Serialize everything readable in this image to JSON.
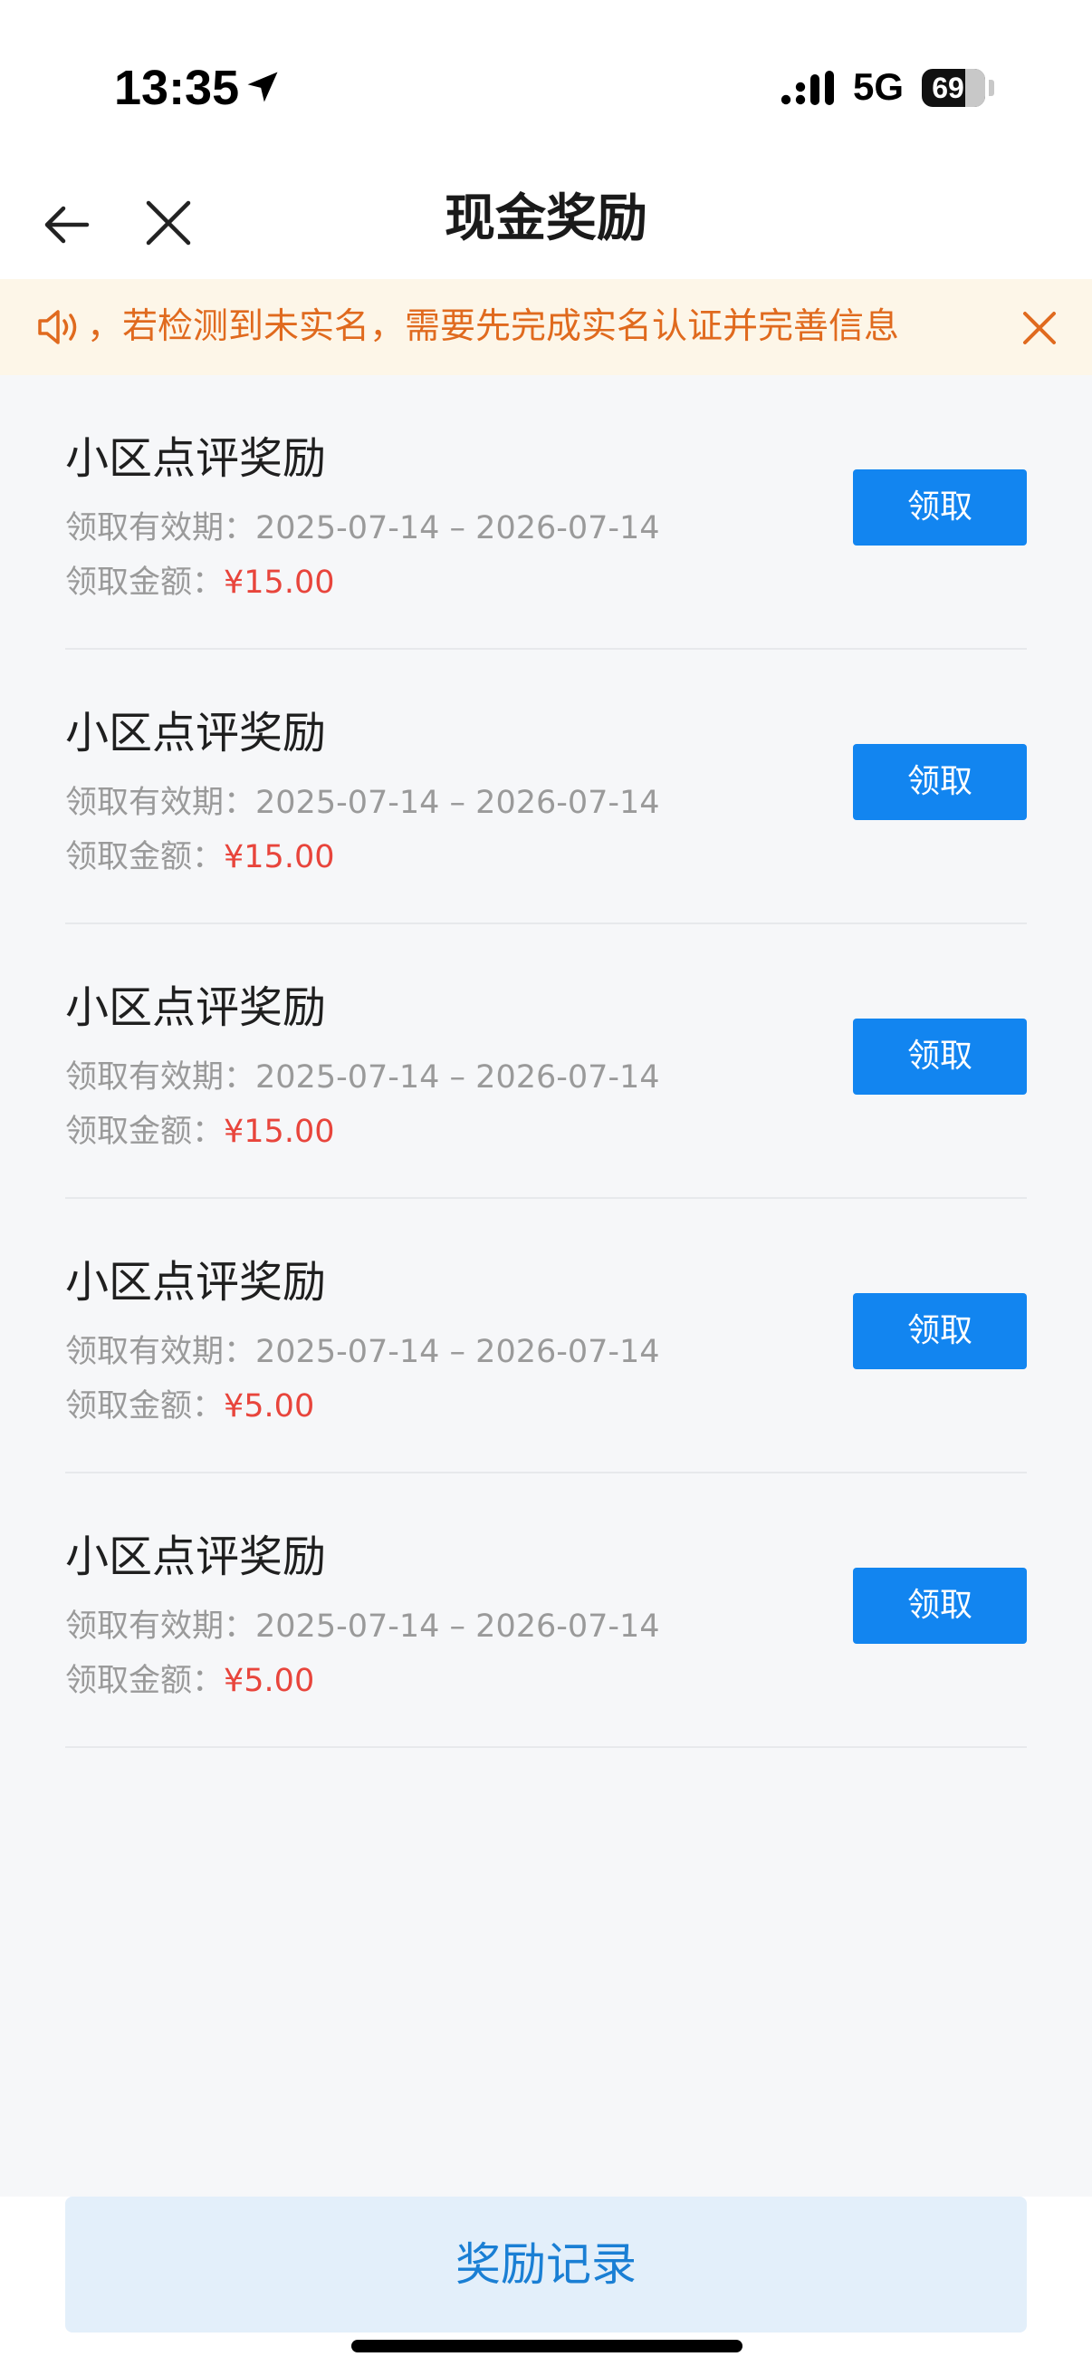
{
  "status_bar": {
    "time": "13:35",
    "network": "5G",
    "battery_level": "69",
    "battery_fraction": 0.69
  },
  "nav": {
    "title": "现金奖励",
    "back_icon": "arrow-left-icon",
    "close_icon": "close-icon"
  },
  "notice": {
    "icon": "speaker-icon",
    "text": "，若检测到未实名，需要先完成实名认证并完善信息",
    "color": "#e06a1e",
    "background": "#fdf6e8"
  },
  "rewards": [
    {
      "title": "小区点评奖励",
      "period_label": "领取有效期：",
      "period": "2025-07-14 – 2026-07-14",
      "amount_label": "领取金额：",
      "amount": "¥15.00",
      "button": "领取"
    },
    {
      "title": "小区点评奖励",
      "period_label": "领取有效期：",
      "period": "2025-07-14 – 2026-07-14",
      "amount_label": "领取金额：",
      "amount": "¥15.00",
      "button": "领取"
    },
    {
      "title": "小区点评奖励",
      "period_label": "领取有效期：",
      "period": "2025-07-14 – 2026-07-14",
      "amount_label": "领取金额：",
      "amount": "¥15.00",
      "button": "领取"
    },
    {
      "title": "小区点评奖励",
      "period_label": "领取有效期：",
      "period": "2025-07-14 – 2026-07-14",
      "amount_label": "领取金额：",
      "amount": "¥5.00",
      "button": "领取"
    },
    {
      "title": "小区点评奖励",
      "period_label": "领取有效期：",
      "period": "2025-07-14 – 2026-07-14",
      "amount_label": "领取金额：",
      "amount": "¥5.00",
      "button": "领取"
    }
  ],
  "bottom": {
    "record_button": "奖励记录"
  },
  "colors": {
    "accent": "#1285f0",
    "amount": "#e8453c",
    "record_button_bg": "#e3effa",
    "record_button_text": "#1a7fd4"
  }
}
